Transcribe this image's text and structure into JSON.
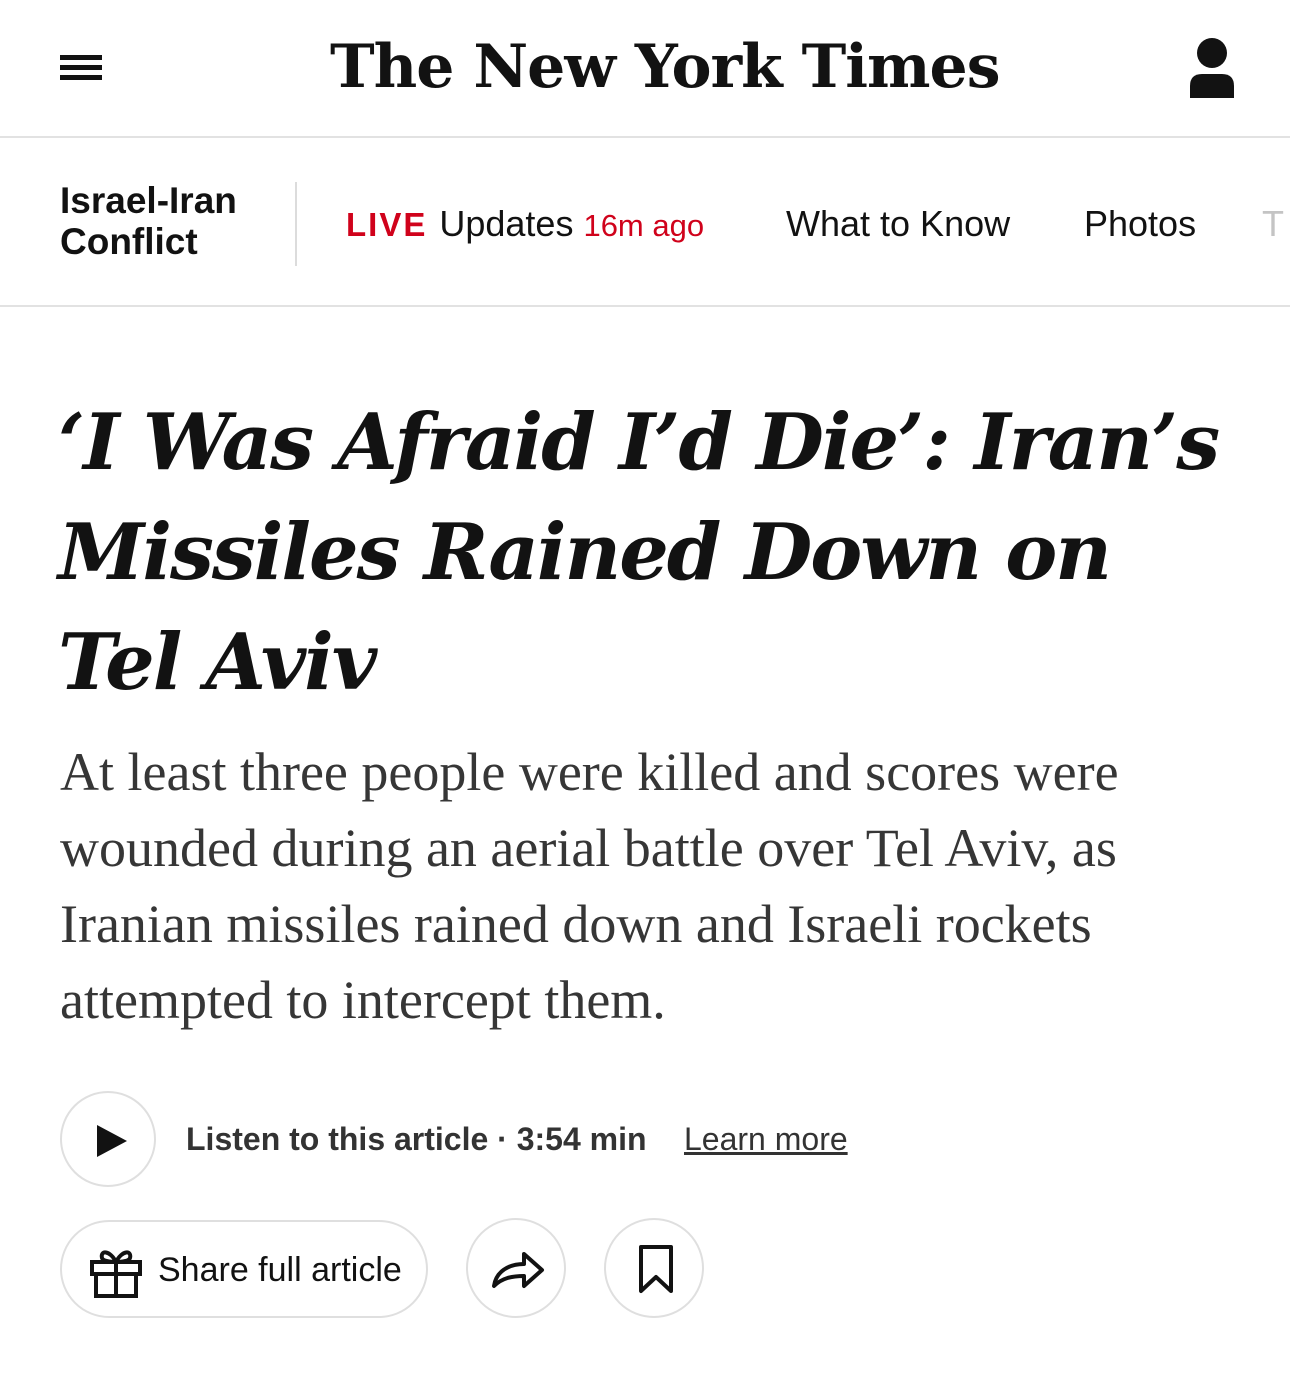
{
  "masthead": {
    "logo_text": "The New York Times",
    "menu_icon": "hamburger-menu-icon",
    "account_icon": "person-account-icon"
  },
  "section_nav": {
    "section_title": "Israel-Iran Conflict",
    "live_tag": "LIVE",
    "live_label": "Updates",
    "live_time": "16m ago",
    "links": [
      "What to Know",
      "Photos",
      "T"
    ]
  },
  "article": {
    "headline": "‘I Was Afraid I’d Die’: Iran’s Missiles Rained Down on Tel Aviv",
    "summary": "At least three people were killed and scores were wounded during an aerial battle over Tel Aviv, as Iranian missiles rained down and Israeli rockets attempted to intercept them."
  },
  "audio": {
    "listen_text": "Listen to this article · 3:54 min",
    "learn_more": "Learn more",
    "play_icon": "play-icon"
  },
  "share": {
    "share_full_label": "Share full article",
    "gift_icon": "gift-icon",
    "share_icon": "share-arrow-icon",
    "save_icon": "bookmark-icon"
  },
  "colors": {
    "live_red": "#d0021b",
    "text": "#121212",
    "summary_text": "#363636",
    "border": "#dfdfdf"
  }
}
